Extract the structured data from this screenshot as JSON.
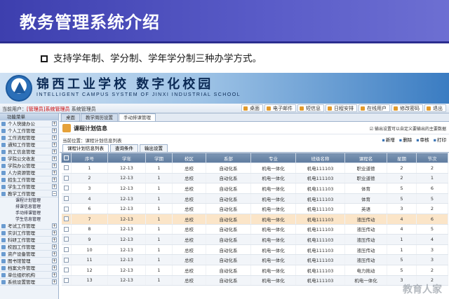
{
  "slide": {
    "title": "教务管理系统介绍",
    "bullet": "支持学年制、学分制、学年学分制三种办学方式。"
  },
  "banner": {
    "school_name_cn": "锦西工业学校 数字化校园",
    "school_name_en": "INTELLIGENT CAMPUS SYSTEM OF JINXI INDUSTRIAL SCHOOL"
  },
  "topbar": {
    "user_prefix": "当前用户：",
    "user_name": "[管理员]系统管理员",
    "user_suffix": " 系统管理员",
    "buttons": [
      "桌面",
      "电子邮件",
      "短信息",
      "日程安排",
      "在线用户",
      "修改密码",
      "退出"
    ]
  },
  "sidebar": {
    "header": "功能菜单",
    "items_top": [
      "个人快捷办公",
      "个人工作管理",
      "工作流程管理",
      "通知工作管理",
      "员工信息管理",
      "学院公文收发",
      "学院办公管理",
      "人力资源管理",
      "招生工作管理",
      "学生工作管理",
      "教学工作管理"
    ],
    "sub_items": [
      "课程计划管理",
      "排课信息管理",
      "手动排课管理",
      "学生信息管理"
    ],
    "items_bottom": [
      "考试工作管理",
      "实训工作管理",
      "科研工作管理",
      "校园工作管理",
      "资产设备管理",
      "图书馆管理",
      "档案文件管理",
      "单位组织机构",
      "系统设置管理"
    ]
  },
  "tabs": [
    "桌面",
    "教学周历设置",
    "手动排课管理"
  ],
  "page": {
    "title": "课程计划信息",
    "tip": "输出设置可以自定义要输出的主要数据",
    "position": "当前位置：课程计划信息列表",
    "actions": [
      "新增",
      "删除",
      "审核",
      "打印"
    ]
  },
  "subtabs": [
    "课程计划信息列表",
    "查询条件",
    "输出设置"
  ],
  "table": {
    "headers": [
      "序号",
      "学年",
      "学期",
      "校区",
      "系部",
      "专业",
      "班级名称",
      "课程名",
      "星期",
      "节次"
    ],
    "rows": [
      [
        "1",
        "12-13",
        "1",
        "总校",
        "自动化系",
        "机电一体化",
        "机电111103",
        "职业道德",
        "2",
        "2"
      ],
      [
        "2",
        "12-13",
        "1",
        "总校",
        "自动化系",
        "机电一体化",
        "机电111103",
        "职业道德",
        "2",
        "1"
      ],
      [
        "3",
        "12-13",
        "1",
        "总校",
        "自动化系",
        "机电一体化",
        "机电111103",
        "体育",
        "5",
        "6"
      ],
      [
        "4",
        "12-13",
        "1",
        "总校",
        "自动化系",
        "机电一体化",
        "机电111103",
        "体育",
        "5",
        "5"
      ],
      [
        "6",
        "12-13",
        "1",
        "总校",
        "自动化系",
        "机电一体化",
        "机电111103",
        "英语",
        "3",
        "2"
      ],
      [
        "7",
        "12-13",
        "1",
        "总校",
        "自动化系",
        "机电一体化",
        "机电111103",
        "液压传动",
        "4",
        "6"
      ],
      [
        "8",
        "12-13",
        "1",
        "总校",
        "自动化系",
        "机电一体化",
        "机电111103",
        "液压传动",
        "4",
        "5"
      ],
      [
        "9",
        "12-13",
        "1",
        "总校",
        "自动化系",
        "机电一体化",
        "机电111103",
        "液压传动",
        "1",
        "4"
      ],
      [
        "10",
        "12-13",
        "1",
        "总校",
        "自动化系",
        "机电一体化",
        "机电111103",
        "液压传动",
        "1",
        "3"
      ],
      [
        "11",
        "12-13",
        "1",
        "总校",
        "自动化系",
        "机电一体化",
        "机电111103",
        "液压传动",
        "5",
        "3"
      ],
      [
        "12",
        "12-13",
        "1",
        "总校",
        "自动化系",
        "机电一体化",
        "机电111103",
        "电力拖动",
        "5",
        "2"
      ],
      [
        "13",
        "12-13",
        "1",
        "总校",
        "自动化系",
        "机电一体化",
        "机电111103",
        "机电一体化",
        "3",
        "2"
      ]
    ],
    "highlight_row": 5
  },
  "watermark": "教育人家",
  "colors": {
    "slide_title_bg": "#4446b4",
    "grid_header": "#6a86a8",
    "highlight_row": "#fbe5c8"
  }
}
